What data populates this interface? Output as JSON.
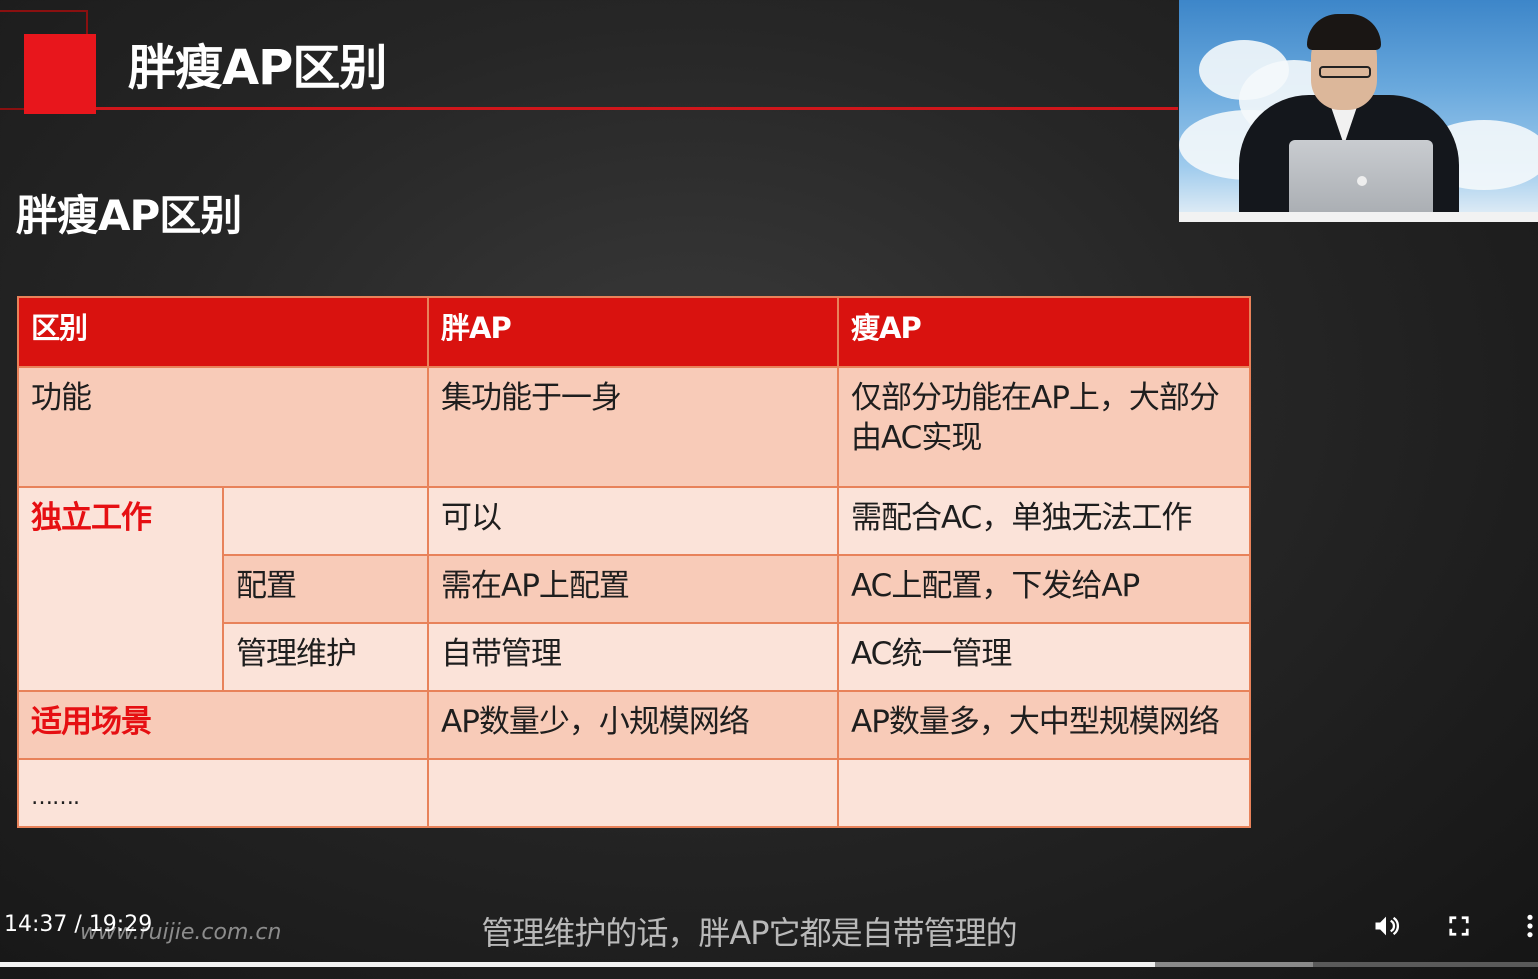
{
  "slide": {
    "header_title": "胖瘦AP区别",
    "subtitle": "胖瘦AP区别"
  },
  "table": {
    "headers": [
      "区别",
      "胖AP",
      "瘦AP"
    ],
    "rows": {
      "function": {
        "label": "功能",
        "fat": "集功能于一身",
        "thin": "仅部分功能在AP上，大部分由AC实现"
      },
      "standalone": {
        "label": "独立工作",
        "fat": "可以",
        "thin": "需配合AC，单独无法工作"
      },
      "config": {
        "label": "配置",
        "fat": "需在AP上配置",
        "thin": "AC上配置，下发给AP"
      },
      "maintenance": {
        "label": "管理维护",
        "fat": "自带管理",
        "thin": "AC统一管理"
      },
      "scenario": {
        "label": "适用场景",
        "fat": "AP数量少，小规模网络",
        "thin": "AP数量多，大中型规模网络"
      },
      "more": {
        "label": "……."
      }
    },
    "colors": {
      "header_bg": "#d9120f",
      "border": "#e8825a",
      "highlight_text": "#e60f12"
    }
  },
  "player": {
    "time_current": "14:37",
    "time_separator": " / ",
    "time_total": "19:29",
    "caption": "管理维护的话，胖AP它都是自带管理的",
    "watermark": "www.ruijie.com.cn",
    "progress_fraction": 0.751,
    "buffer_fraction": 0.854
  }
}
